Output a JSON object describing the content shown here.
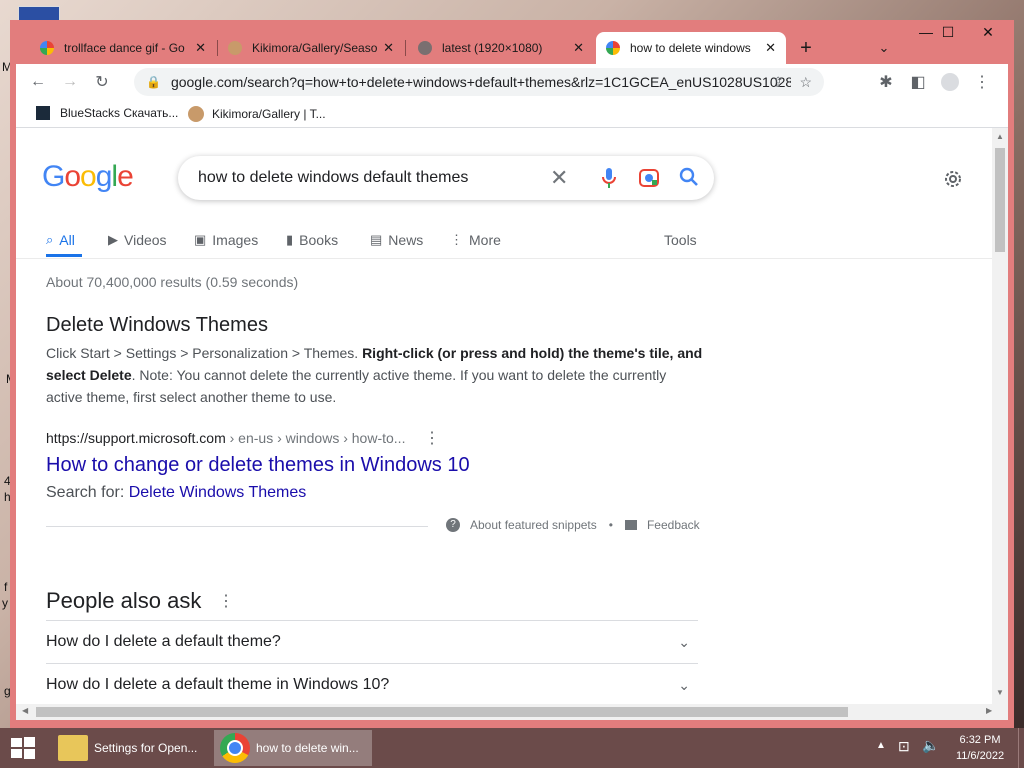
{
  "desktop": {
    "fragments": [
      "M",
      "M",
      "4",
      "h",
      "f",
      "y",
      "g"
    ]
  },
  "browser": {
    "tabs": [
      {
        "title": "trollface dance gif - Go",
        "active": false,
        "favicon": "google-icon"
      },
      {
        "title": "Kikimora/Gallery/Seaso",
        "active": false,
        "favicon": "kikimora-icon"
      },
      {
        "title": "latest (1920×1080)",
        "active": false,
        "favicon": "globe-icon"
      },
      {
        "title": "how to delete windows",
        "active": true,
        "favicon": "google-icon"
      }
    ],
    "new_tab_label": "+",
    "url": "google.com/search?q=how+to+delete+windows+default+themes&rlz=1C1GCEA_enUS1028US1028...",
    "bookmarks": [
      {
        "label": "BlueStacks Скачать...",
        "icon": "bluestacks-icon"
      },
      {
        "label": "Kikimora/Gallery | T...",
        "icon": "kikimora-icon"
      }
    ]
  },
  "google": {
    "logo": "Google",
    "query": "how to delete windows default themes",
    "nav": [
      {
        "label": "All",
        "icon": "search-icon",
        "active": true
      },
      {
        "label": "Videos",
        "icon": "play-icon",
        "active": false
      },
      {
        "label": "Images",
        "icon": "image-icon",
        "active": false
      },
      {
        "label": "Books",
        "icon": "book-icon",
        "active": false
      },
      {
        "label": "News",
        "icon": "news-icon",
        "active": false
      },
      {
        "label": "More",
        "icon": "more-icon",
        "active": false
      }
    ],
    "tools_label": "Tools",
    "result_stats": "About 70,400,000 results (0.59 seconds)",
    "snippet": {
      "heading": "Delete Windows Themes",
      "text_part1": "Click Start > Settings > Personalization > Themes. ",
      "text_bold": "Right-click (or press and hold) the theme's tile, and select Delete",
      "text_part2": ". Note: You cannot delete the currently active theme. If you want to delete the currently active theme, first select another theme to use.",
      "source_url": "https://support.microsoft.com",
      "source_path": " › en-us › windows › how-to...",
      "link_title": "How to change or delete themes in Windows 10",
      "search_for_label": "Search for: ",
      "search_for_link": "Delete Windows Themes",
      "about_label": "About featured snippets",
      "dot": "•",
      "feedback_label": "Feedback"
    },
    "paa": {
      "title": "People also ask",
      "questions": [
        "How do I delete a default theme?",
        "How do I delete a default theme in Windows 10?"
      ]
    }
  },
  "taskbar": {
    "items": [
      {
        "label": "Settings for Open...",
        "icon": "folder-icon",
        "active": false
      },
      {
        "label": "how to delete win...",
        "icon": "chrome-icon",
        "active": true
      }
    ],
    "time": "6:32 PM",
    "date": "11/6/2022"
  },
  "colors": {
    "window_frame": "#e27d7d",
    "google_blue": "#4285f4",
    "link": "#1a0dab",
    "taskbar": "#6b4b4a"
  }
}
